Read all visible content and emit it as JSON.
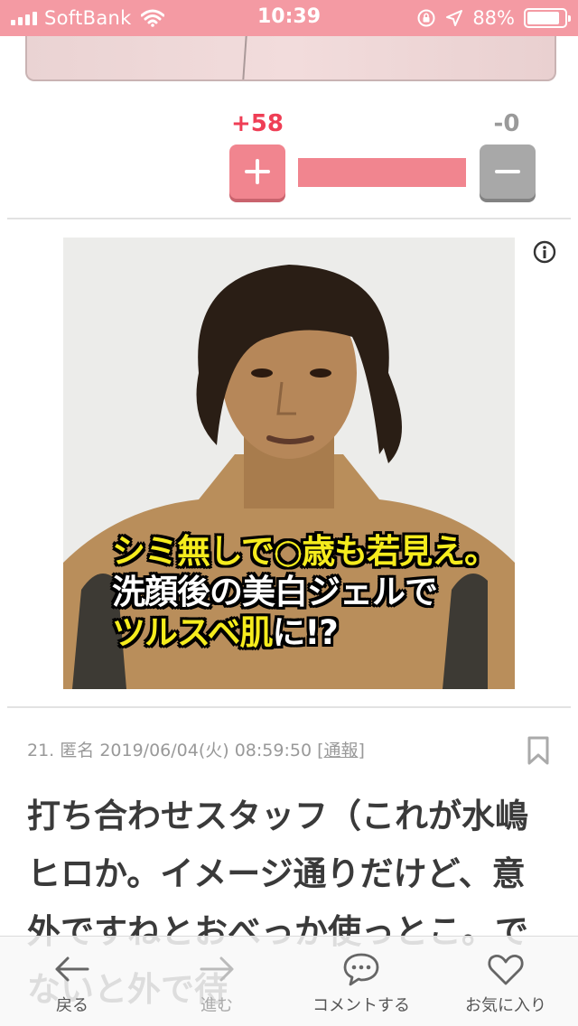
{
  "status_bar": {
    "carrier": "SoftBank",
    "time": "10:39",
    "battery": "88%",
    "battery_level": 0.88
  },
  "vote": {
    "plus_count": "+58",
    "minus_count": "-0",
    "plus_ratio": 1.0,
    "colors": {
      "plus": "#f1858f",
      "minus": "#a8a8a8",
      "plus_text": "#ef3e55"
    }
  },
  "ad": {
    "caption_lines": [
      {
        "parts": [
          {
            "text": "シミ無しで○歳も若見え。",
            "color": "yellow"
          }
        ]
      },
      {
        "parts": [
          {
            "text": "洗顔後の美白ジェルで",
            "color": "white"
          }
        ]
      },
      {
        "parts": [
          {
            "text": "ツルスベ肌",
            "color": "yellow"
          },
          {
            "text": "に!?",
            "color": "white"
          }
        ]
      }
    ],
    "icons": {
      "info": "info-icon"
    }
  },
  "comment": {
    "number": "21.",
    "author": "匿名",
    "datetime": "2019/06/04(火) 08:59:50",
    "report": "[通報]",
    "body": "打ち合わせスタッフ（これが水嶋ヒロか。イメージ通りだけど、意外ですねとおべっか使っとこ。でないと外で待"
  },
  "bottom_bar": {
    "back": "戻る",
    "forward": "進む",
    "comment": "コメントする",
    "favorite": "お気に入り"
  }
}
